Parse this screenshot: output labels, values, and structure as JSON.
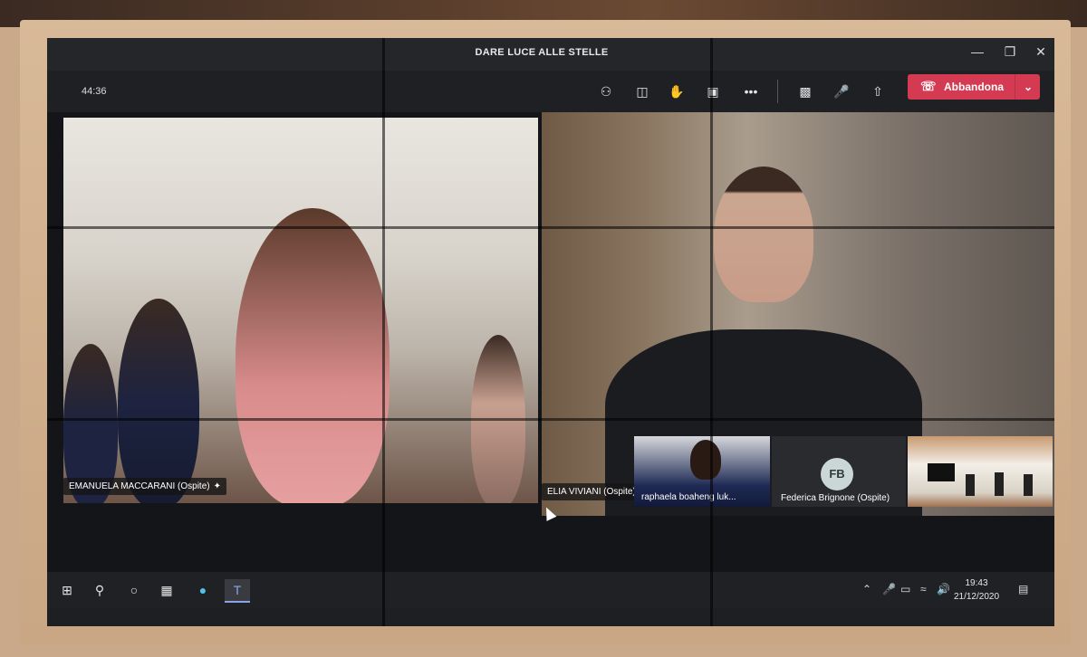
{
  "window": {
    "title": "DARE LUCE ALLE STELLE",
    "minimize_icon": "minimize-icon",
    "restore_icon": "restore-icon",
    "close_icon": "close-icon"
  },
  "toolbar": {
    "call_timer": "44:36",
    "leave_label": "Abbandona",
    "icons": [
      "participants-icon",
      "chat-icon",
      "raise-hand-icon",
      "rooms-icon",
      "more-icon",
      "camera-icon",
      "microphone-icon",
      "share-screen-icon",
      "phone-hangup-icon",
      "chevron-down-icon"
    ]
  },
  "participants": {
    "main_left": {
      "name": "EMANUELA MACCARANI (Ospite)"
    },
    "main_right": {
      "name": "ELIA VIVIANI (Ospite)"
    },
    "mini_1": {
      "name": "raphaela boaheng luk..."
    },
    "mini_2": {
      "name": "Federica Brignone (Ospite)",
      "initials": "FB"
    }
  },
  "taskbar": {
    "clock_time": "19:43",
    "clock_date": "21/12/2020"
  },
  "colors": {
    "leave_button": "#d43a52",
    "teams_bg": "#1f2024",
    "accent": "#8aa4e8"
  }
}
